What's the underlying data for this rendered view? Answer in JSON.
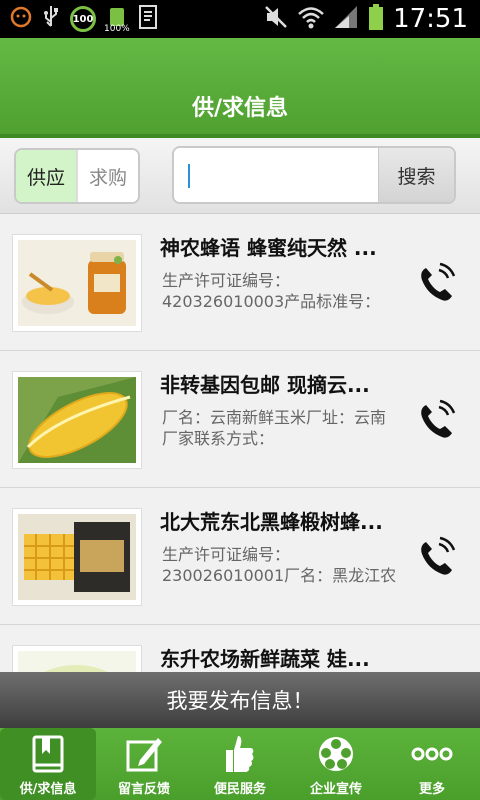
{
  "status_bar": {
    "time": "17:51",
    "badge_value": "100",
    "battery_small_label": "100%"
  },
  "header": {
    "title": "供/求信息"
  },
  "filter": {
    "tab_supply": "供应",
    "tab_demand": "求购",
    "search_placeholder": "",
    "search_button": "搜索"
  },
  "list": {
    "items": [
      {
        "title": "神农蜂语 蜂蜜纯天然 ...",
        "desc_line1": "生产许可证编号：",
        "desc_line2": "420326010003产品标准号：",
        "thumb_icon": "honey-jar-image"
      },
      {
        "title": "非转基因包邮 现摘云...",
        "desc_line1": "厂名：云南新鲜玉米厂址：云南",
        "desc_line2": "厂家联系方式：",
        "thumb_icon": "corn-image"
      },
      {
        "title": "北大荒东北黑蜂椴树蜂...",
        "desc_line1": "生产许可证编号：",
        "desc_line2": "230026010001厂名：黑龙江农",
        "thumb_icon": "honeycomb-box-image"
      },
      {
        "title": "东升农场新鲜蔬菜 娃...",
        "desc_line1": "",
        "desc_line2": "",
        "thumb_icon": "vegetable-image"
      }
    ]
  },
  "publish": {
    "label": "我要发布信息！"
  },
  "bottom_nav": {
    "items": [
      {
        "label": "供/求信息",
        "icon": "book-icon"
      },
      {
        "label": "留言反馈",
        "icon": "edit-icon"
      },
      {
        "label": "便民服务",
        "icon": "thumbs-up-icon"
      },
      {
        "label": "企业宣传",
        "icon": "film-reel-icon"
      },
      {
        "label": "更多",
        "icon": "more-dots-icon"
      }
    ]
  },
  "colors": {
    "header_green": "#5cb33b",
    "active_tab_bg": "#d3f3c8",
    "publish_bar": "#4a4a4a"
  }
}
